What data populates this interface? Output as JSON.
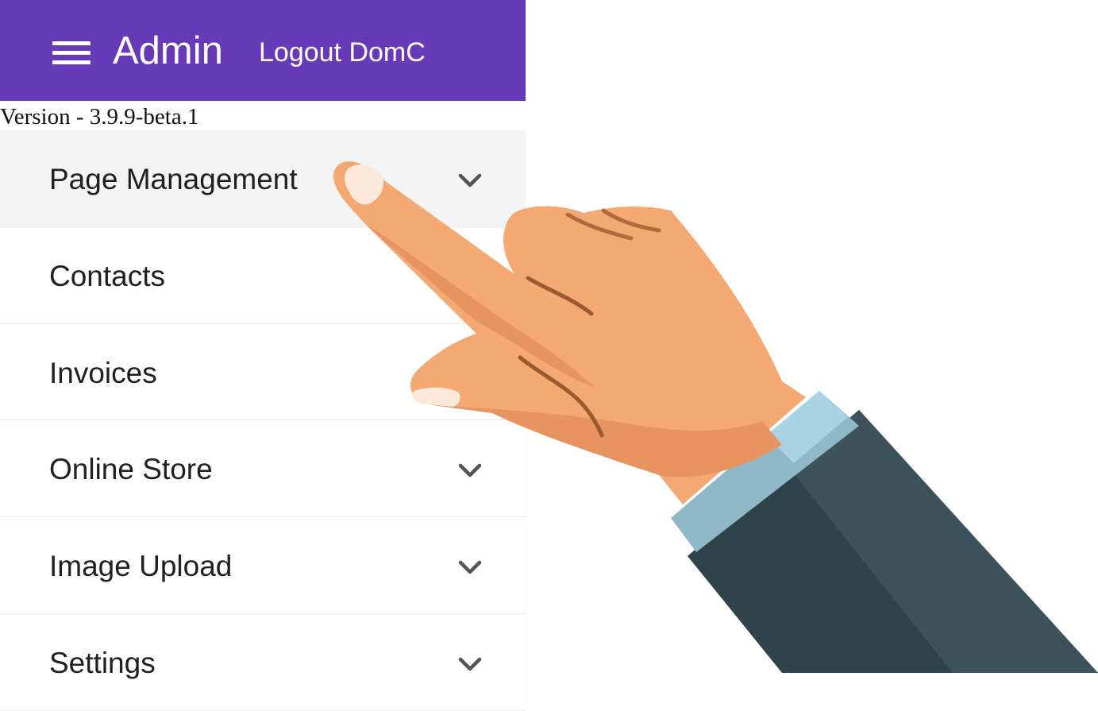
{
  "header": {
    "title": "Admin",
    "logout_label": "Logout DomC",
    "menu_icon": "hamburger-menu-icon",
    "background_color": "#673ab7"
  },
  "version_text": "Version - 3.9.9-beta.1",
  "sidebar": {
    "items": [
      {
        "label": "Page Management",
        "has_submenu": true,
        "active": true
      },
      {
        "label": "Contacts",
        "has_submenu": false,
        "active": false
      },
      {
        "label": "Invoices",
        "has_submenu": false,
        "active": false
      },
      {
        "label": "Online Store",
        "has_submenu": true,
        "active": false
      },
      {
        "label": "Image Upload",
        "has_submenu": true,
        "active": false
      },
      {
        "label": "Settings",
        "has_submenu": true,
        "active": false
      }
    ],
    "expand_icon": "chevron-down-icon"
  },
  "overlay": {
    "icon": "pointing-hand-icon"
  }
}
